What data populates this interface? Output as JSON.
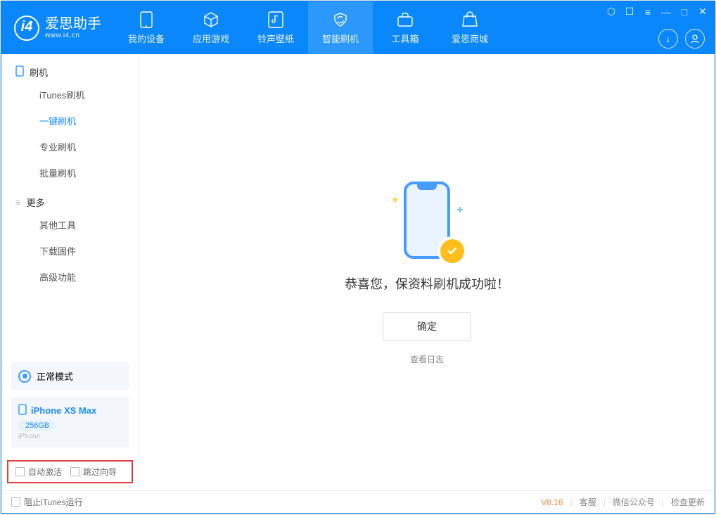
{
  "brand": {
    "cn": "爱思助手",
    "en": "www.i4.cn"
  },
  "nav": {
    "my_device": "我的设备",
    "apps_games": "应用游戏",
    "ringtones": "铃声壁纸",
    "smart_flash": "智能刷机",
    "toolbox": "工具箱",
    "store": "爱思商城"
  },
  "sidebar": {
    "group_flash": "刷机",
    "items_flash": [
      "iTunes刷机",
      "一键刷机",
      "专业刷机",
      "批量刷机"
    ],
    "group_more": "更多",
    "items_more": [
      "其他工具",
      "下载固件",
      "高级功能"
    ],
    "mode": "正常模式",
    "device_name": "iPhone XS Max",
    "device_storage": "256GB",
    "device_type": "iPhone",
    "auto_activate": "自动激活",
    "skip_guide": "跳过向导"
  },
  "main": {
    "success": "恭喜您，保资料刷机成功啦！",
    "ok": "确定",
    "view_log": "查看日志"
  },
  "footer": {
    "block_itunes": "阻止iTunes运行",
    "version": "V8.16",
    "support": "客服",
    "wechat": "微信公众号",
    "update": "检查更新"
  }
}
